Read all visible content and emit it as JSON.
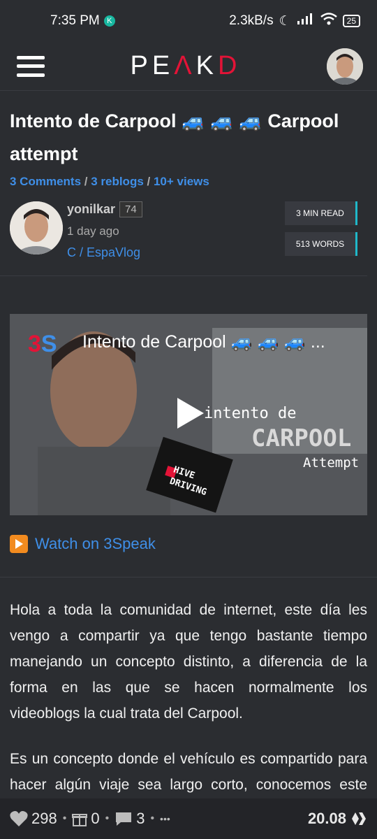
{
  "status_bar": {
    "time": "7:35 PM",
    "badge": "K",
    "network_speed": "2.3kB/s",
    "battery": "25"
  },
  "header": {
    "logo_left": "PE",
    "logo_mid": "Λ",
    "logo_right": "K",
    "logo_end": "D"
  },
  "post": {
    "title": "Intento de Carpool 🚙 🚙 🚙 Carpool attempt",
    "comments": "3 Comments",
    "reblogs": "3 reblogs",
    "views": "10+ views",
    "separator": " / "
  },
  "author": {
    "name": "yonilkar",
    "reputation": "74",
    "date": "1 day ago",
    "community": "C / EspaVlog",
    "read_time": "3 MIN READ",
    "word_count": "513 WORDS"
  },
  "video": {
    "title": "Intento de Carpool 🚙 🚙 🚙 ...",
    "overlay_top": "intento de",
    "overlay_main": "CARPOOL",
    "overlay_bottom": "Attempt",
    "sticker_line1": "HIVE",
    "sticker_line2": "DRIVING"
  },
  "watch_link": "Watch on 3Speak",
  "body": {
    "paragraph1": "Hola a toda la comunidad de internet, este día les vengo a compartir ya que tengo bastante tiempo manejando un concepto distinto, a diferencia de la forma en las que se hacen normalmente los videoblogs la cual trata del Carpool.",
    "paragraph2": "Es un concepto donde el vehículo es compartido para hacer algún viaje sea largo corto, conocemos este concepto o se hizo más viral"
  },
  "footer": {
    "likes": "298",
    "gifts": "0",
    "comments": "3",
    "more": "•••",
    "payout": "20.08"
  },
  "colors": {
    "background": "#2b2d31",
    "link": "#3f8fe8",
    "brand_red": "#e31337",
    "badge_accent": "#1fb8c9"
  }
}
